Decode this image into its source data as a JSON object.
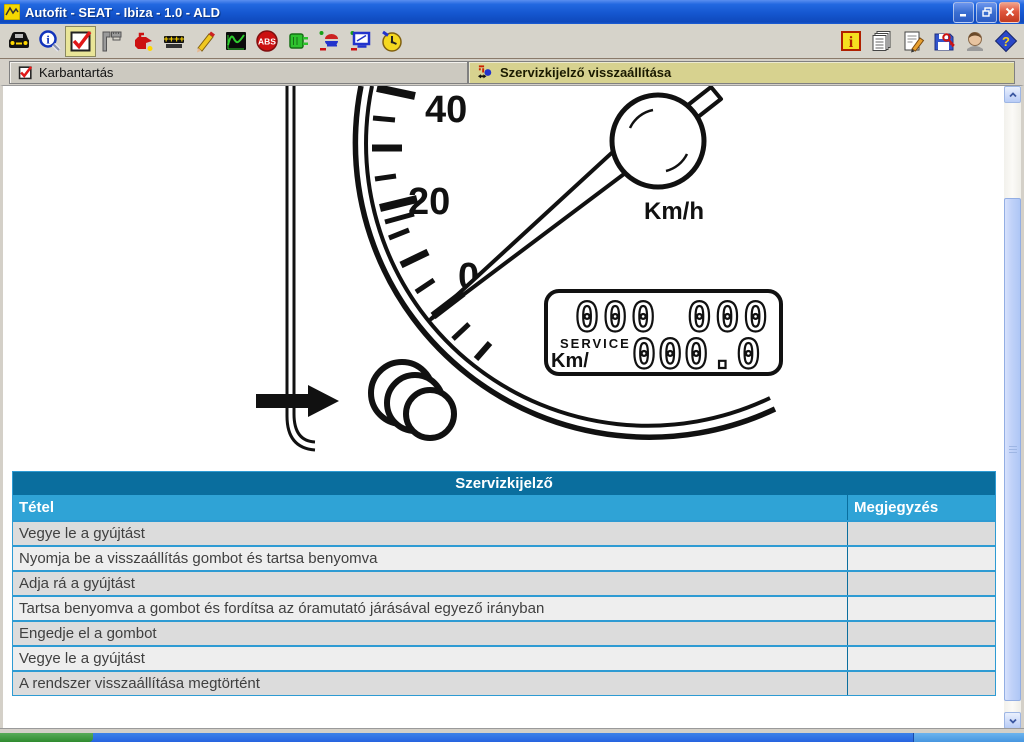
{
  "window": {
    "title": "Autofit - SEAT - Ibiza - 1.0 - ALD",
    "controls": [
      "minimize",
      "restore",
      "close"
    ]
  },
  "toolbar": {
    "left_icons": [
      "vehicle-car-icon",
      "identify-magnifier-info-icon",
      "maintenance-checkbox-icon",
      "technical-data-caliper-icon",
      "lubricants-oil-can-icon",
      "engine-timing-icon",
      "notes-pencil-icon",
      "diagnostics-oscilloscope-icon",
      "brakes-abs-icon",
      "electrics-connector-icon",
      "ignition-icon",
      "wiring-diagram-monitor-icon",
      "service-times-clock-icon"
    ],
    "right_icons": [
      "info-icon",
      "documents-icon",
      "edit-note-icon",
      "save-security-key-icon",
      "contact-person-icon",
      "help-icon"
    ],
    "active_left_index": 2
  },
  "tabs": [
    {
      "label": "Karbantartás",
      "active": false,
      "icon": "checkbox-checked-icon"
    },
    {
      "label": "Szervizkijelző visszaállítása",
      "active": true,
      "icon": "reset-indicator-icon"
    }
  ],
  "diagram": {
    "speed_labels": {
      "s40": "40",
      "s20": "20",
      "s0": "0"
    },
    "unit_label": "Km/h",
    "odometer_top": "000 000",
    "service_label": "SERVICE",
    "km_label": "Km/",
    "odometer_bottom": "000.0"
  },
  "table": {
    "title": "Szervizkijelző",
    "columns": {
      "item": "Tétel",
      "note": "Megjegyzés"
    },
    "rows": [
      {
        "tetel": "Vegye le a gyújtást",
        "megjegyzes": ""
      },
      {
        "tetel": "Nyomja be a visszaállítás gombot és tartsa benyomva",
        "megjegyzes": ""
      },
      {
        "tetel": "Adja rá a gyújtást",
        "megjegyzes": ""
      },
      {
        "tetel": "Tartsa benyomva a gombot és fordítsa az óramutató járásával egyező irányban",
        "megjegyzes": ""
      },
      {
        "tetel": "Engedje el a gombot",
        "megjegyzes": ""
      },
      {
        "tetel": "Vegye le a gyújtást",
        "megjegyzes": ""
      },
      {
        "tetel": "A rendszer visszaállítása megtörtént",
        "megjegyzes": ""
      }
    ]
  },
  "colors": {
    "titlebar_blue": "#1557D0",
    "active_tab_khaki": "#D7D28F",
    "table_title_bg": "#0A6E9E",
    "table_header_bg": "#2FA3D6",
    "row_separator_blue": "#2E9BD3",
    "row_dark": "#DCDCDC",
    "row_light": "#EEEEEE",
    "taskbar_blue": "#2663E0",
    "start_green": "#2F8B2F"
  }
}
